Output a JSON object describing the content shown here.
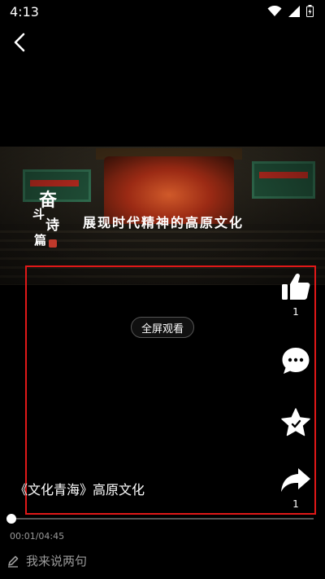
{
  "status_bar": {
    "time": "4:13",
    "icons": [
      "wifi-icon",
      "signal-icon",
      "battery-icon"
    ]
  },
  "nav": {
    "back_icon": "chevron-left-icon"
  },
  "video": {
    "overlay_calligraphy": [
      "奋",
      "斗",
      "诗",
      "篇"
    ],
    "overlay_title": "展现时代精神的高原文化",
    "fullscreen_label": "全屏观看"
  },
  "actions": {
    "like": {
      "icon": "thumbs-up-icon",
      "count": "1"
    },
    "comment": {
      "icon": "comment-icon"
    },
    "favorite": {
      "icon": "star-icon"
    },
    "share": {
      "icon": "share-icon",
      "count": "1"
    }
  },
  "video_title": "《文化青海》高原文化",
  "player": {
    "progress": 0.0,
    "timecode": "00:01/04:45"
  },
  "comment_input": {
    "icon": "pencil-icon",
    "placeholder": "我来说两句"
  },
  "colors": {
    "highlight": "#e01818",
    "background": "#000000"
  }
}
